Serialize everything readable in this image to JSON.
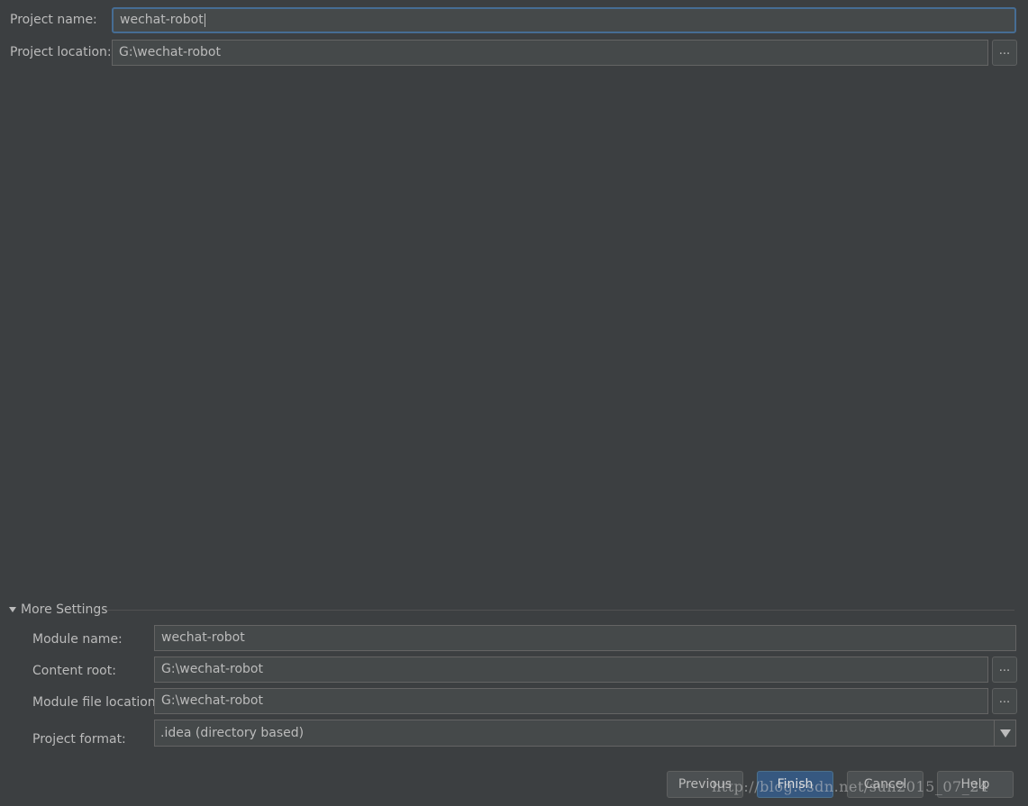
{
  "project": {
    "name_label": "Project name:",
    "name_value": "wechat-robot",
    "location_label": "Project location:",
    "location_value": "G:\\wechat-robot",
    "browse_label": "..."
  },
  "more_settings": {
    "title": "More Settings",
    "module_name_label": "Module name:",
    "module_name_value": "wechat-robot",
    "content_root_label": "Content root:",
    "content_root_value": "G:\\wechat-robot",
    "module_file_label": "Module file location:",
    "module_file_value": "G:\\wechat-robot",
    "project_format_label": "Project format:",
    "project_format_value": ".idea (directory based)",
    "browse_label": "..."
  },
  "buttons": {
    "previous": "Previous",
    "finish": "Finish",
    "cancel": "Cancel",
    "help": "Help"
  },
  "watermark": "http://blog.csdn.net/sun2015_07_24",
  "colors": {
    "background": "#3c3f41",
    "field_bg": "#45494a",
    "focus_border": "#466d94",
    "primary_button": "#365880",
    "text": "#bbbbbb"
  }
}
